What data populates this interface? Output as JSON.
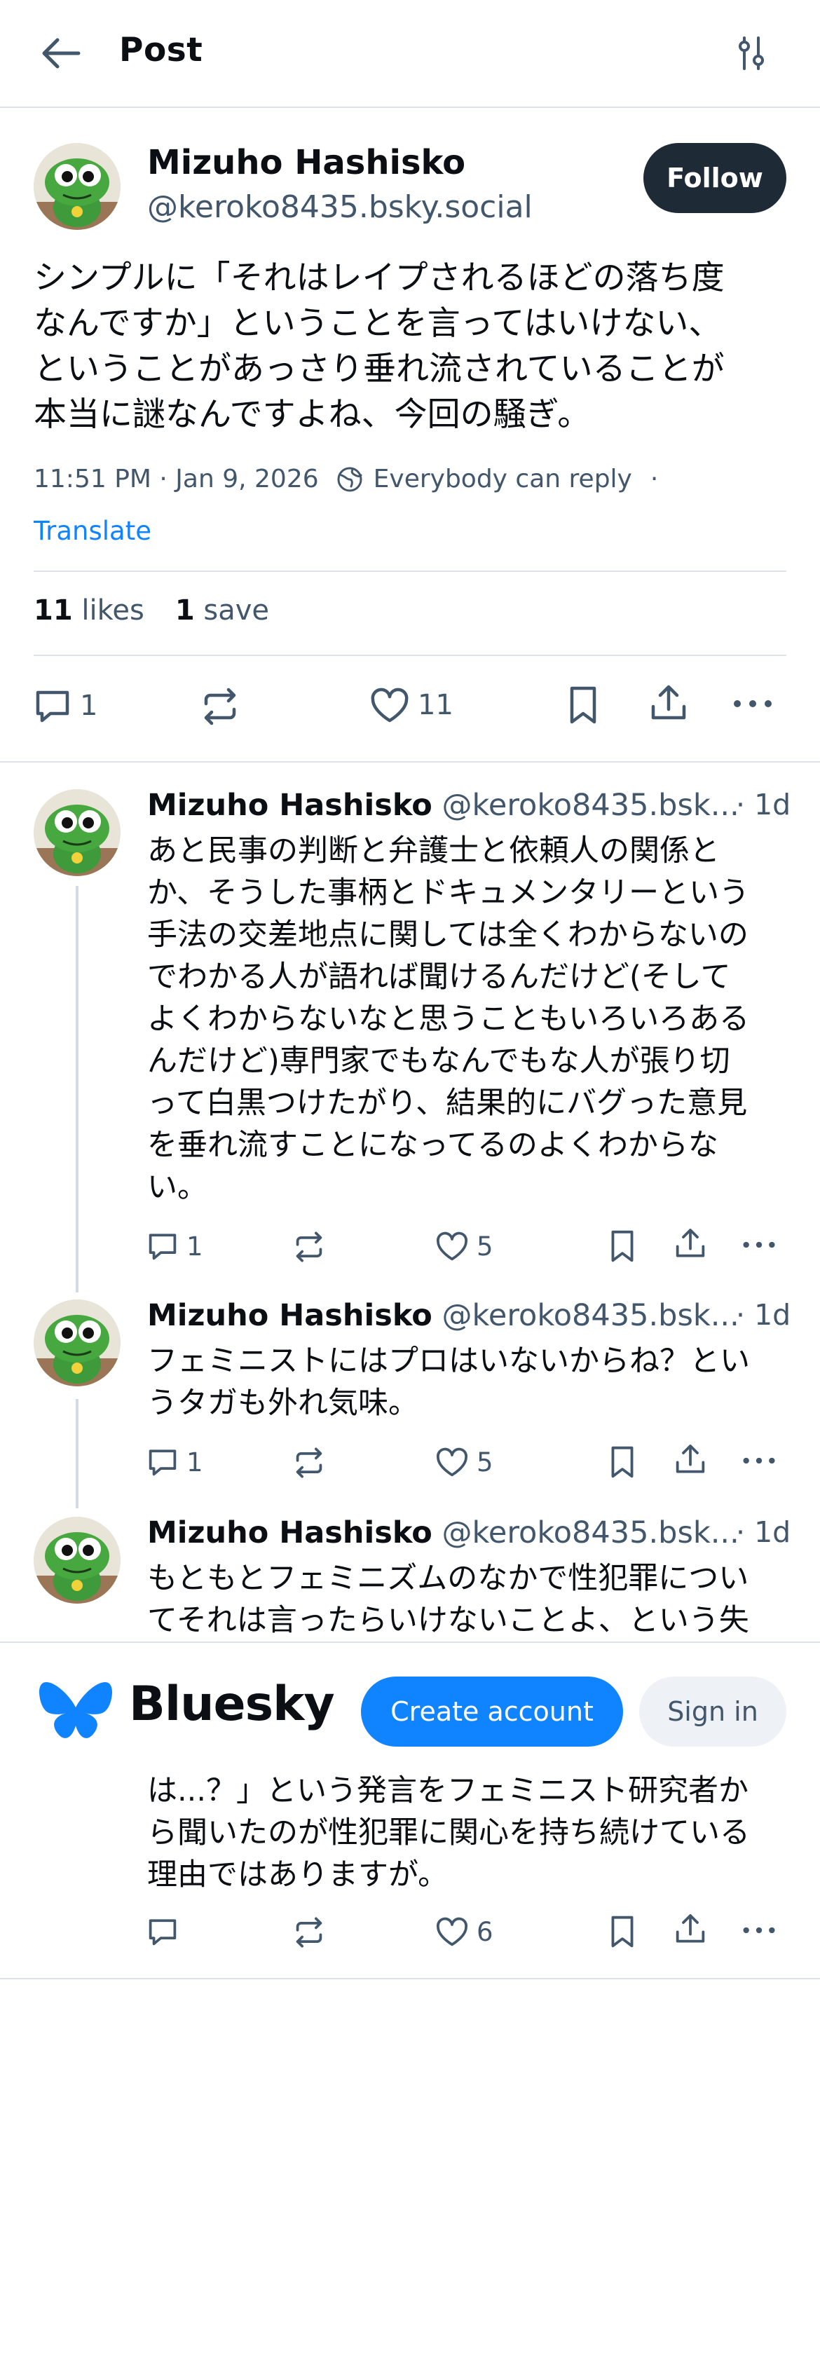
{
  "header": {
    "title": "Post"
  },
  "post": {
    "author_name": "Mizuho Hashisko",
    "author_handle": "@keroko8435.bsky.social",
    "follow_label": "Follow",
    "lines": [
      "シンプルに「それはレイプされるほどの落ち度",
      "なんですか」ということを言ってはいけない、",
      "ということがあっさり垂れ流されていることが",
      "本当に謎なんですよね、今回の騒ぎ。"
    ],
    "timestamp": "11:51 PM · Jan 9, 2026",
    "reply_setting": "Everybody can reply",
    "meta_sep": "·",
    "translate_label": "Translate",
    "likes_count": "11",
    "likes_label": "likes",
    "saves_count": "1",
    "saves_label": "save",
    "reply_count": "1",
    "like_count": "11"
  },
  "replies": [
    {
      "author_name": "Mizuho Hashisko",
      "author_handle": "@keroko8435.bsk...",
      "time": "· 1d",
      "lines": [
        "あと民事の判断と弁護士と依頼人の関係と",
        "か、そうした事柄とドキュメンタリーという",
        "手法の交差地点に関しては全くわからないの",
        "でわかる人が語れば聞けるんだけど(そして",
        "よくわからないなと思うこともいろいろある",
        "んだけど)専門家でもなんでもな人が張り切",
        "って白黒つけたがり、結果的にバグった意見",
        "を垂れ流すことになってるのよくわからな",
        "い。"
      ],
      "reply_count": "1",
      "like_count": "5"
    },
    {
      "author_name": "Mizuho Hashisko",
      "author_handle": "@keroko8435.bsk...",
      "time": "· 1d",
      "lines": [
        "フェミニストにはプロはいないからね？とい",
        "うタガも外れ気味。"
      ],
      "reply_count": "1",
      "like_count": "5"
    },
    {
      "author_name": "Mizuho Hashisko",
      "author_handle": "@keroko8435.bsk...",
      "time": "· 1d",
      "lines": [
        "もともとフェミニズムのなかで性犯罪につい",
        "てそれは言ったらいけないことよ、という失"
      ],
      "lines_after_banner": [
        "は...？」という発言をフェミニスト研究者か",
        "ら聞いたのが性犯罪に関心を持ち続けている",
        "理由ではありますが。"
      ],
      "like_count": "6"
    }
  ],
  "banner": {
    "brand": "Bluesky",
    "create_label": "Create account",
    "signin_label": "Sign in",
    "brand_color": "#1083fe"
  }
}
